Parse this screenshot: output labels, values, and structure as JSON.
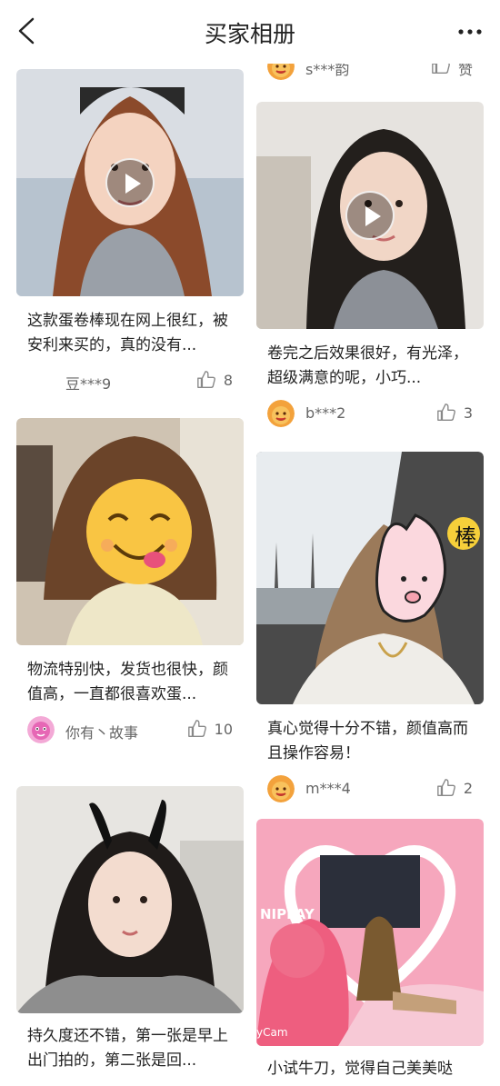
{
  "header": {
    "title": "买家相册",
    "back_icon": "chevron-left-icon",
    "more_icon": "ellipsis-icon"
  },
  "cards": [
    {
      "caption": "",
      "user": "s***韵",
      "likes": "赞",
      "has_video": false,
      "avatar": "orange-face-avatar"
    },
    {
      "caption": "这款蛋卷棒现在网上很红，被安利来买的，真的没有...",
      "user": "豆***9",
      "likes": "8",
      "has_video": true,
      "avatar": "none"
    },
    {
      "caption": "卷完之后效果很好，有光泽，超级满意的呢，小巧...",
      "user": "b***2",
      "likes": "3",
      "has_video": true,
      "avatar": "orange-face-avatar"
    },
    {
      "caption": "物流特别快，发货也很快，颜值高，一直都很喜欢蛋...",
      "user": "你有丶故事",
      "likes": "10",
      "has_video": false,
      "avatar": "pink-face-avatar"
    },
    {
      "caption": "真心觉得十分不错，颜值高而且操作容易！",
      "user": "m***4",
      "likes": "2",
      "has_video": false,
      "avatar": "orange-face-avatar"
    },
    {
      "caption": "持久度还不错，第一张是早上出门拍的，第二张是回...",
      "user": "",
      "likes": "",
      "has_video": false,
      "avatar": "none"
    },
    {
      "caption": "小试牛刀，觉得自己美美哒",
      "user": "",
      "likes": "",
      "has_video": false,
      "avatar": "none"
    }
  ],
  "photo_texts": {
    "sticker_badge": "棒",
    "photo6_sign": "NIPLAY",
    "photo6_brand": "yCam"
  },
  "colors": {
    "accent_orange": "#f3a23c",
    "text_dark": "#222222",
    "text_meta": "#666666"
  }
}
